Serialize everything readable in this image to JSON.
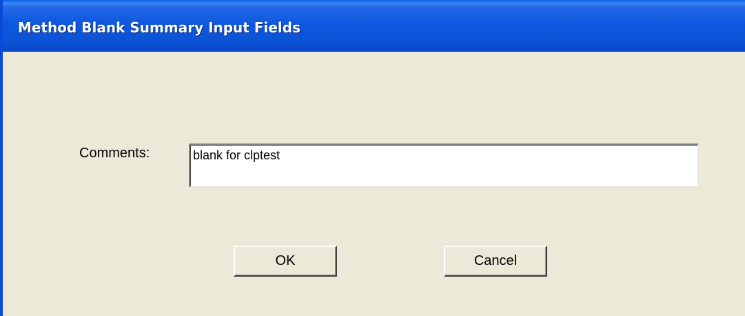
{
  "window": {
    "title": "Method Blank Summary Input Fields"
  },
  "form": {
    "comments_label": "Comments:",
    "comments_value": "blank for clptest"
  },
  "buttons": {
    "ok_label": "OK",
    "cancel_label": "Cancel"
  },
  "colors": {
    "titlebar": "#0b53d6",
    "dialog_background": "#ece9d8",
    "title_text": "#ffffff"
  }
}
